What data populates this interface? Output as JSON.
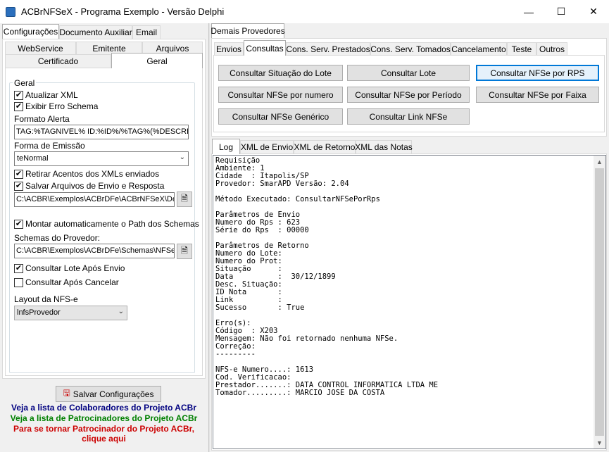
{
  "window": {
    "title": "ACBrNFSeX - Programa Exemplo - Versão Delphi",
    "minimize": "—",
    "maximize": "☐",
    "close": "✕"
  },
  "left": {
    "top_tabs": [
      "Configurações",
      "Documento Auxiliar",
      "Email"
    ],
    "sub_tabs_row1": [
      "WebService",
      "Emitente",
      "Arquivos"
    ],
    "sub_tabs_row2": [
      "Certificado",
      "Geral"
    ],
    "group_title": "Geral",
    "atualizar_xml": {
      "label": "Atualizar XML",
      "checked": true
    },
    "exibir_erro": {
      "label": "Exibir Erro Schema",
      "checked": true
    },
    "formato_alerta_label": "Formato Alerta",
    "formato_alerta_value": "TAG:%TAGNIVEL% ID:%ID%/%TAG%(%DESCRI",
    "forma_emissao_label": "Forma de Emissão",
    "forma_emissao_value": "teNormal",
    "retirar_acentos": {
      "label": "Retirar Acentos dos XMLs enviados",
      "checked": true
    },
    "salvar_arquivos": {
      "label": "Salvar Arquivos de Envio e Resposta",
      "checked": true
    },
    "path_value": "C:\\ACBR\\Exemplos\\ACBrDFe\\ACBrNFSeX\\Delp",
    "montar_path": {
      "label": "Montar automaticamente o Path dos Schemas",
      "checked": true
    },
    "schemas_label": "Schemas do Provedor:",
    "schemas_value": "C:\\ACBR\\Exemplos\\ACBrDFe\\Schemas\\NFSe",
    "consultar_lote": {
      "label": "Consultar Lote Após Envio",
      "checked": true
    },
    "consultar_cancelar": {
      "label": "Consultar Após Cancelar",
      "checked": false
    },
    "layout_label": "Layout da NFS-e",
    "layout_value": "lnfsProvedor",
    "save_button": "Salvar Configurações",
    "link_colaboradores": "Veja a lista de Colaboradores do Projeto ACBr",
    "link_patrocinadores": "Veja a lista de Patrocinadores do Projeto ACBr",
    "link_patrocinador_1": "Para se tornar Patrocinador do Projeto ACBr,",
    "link_patrocinador_2": "clique aqui",
    "colors": {
      "colaboradores": "#000080",
      "patrocinadores": "#008000",
      "patrocinador": "#cc0000"
    }
  },
  "right": {
    "top_tab": "Demais Provedores",
    "tabs": [
      "Envios",
      "Consultas",
      "Cons. Serv. Prestados",
      "Cons. Serv. Tomados",
      "Cancelamento",
      "Teste",
      "Outros"
    ],
    "buttons": [
      "Consultar Situação do Lote",
      "Consultar Lote",
      "Consultar NFSe por RPS",
      "Consultar NFSe por numero",
      "Consultar NFSe por Período",
      "Consultar NFSe por Faixa",
      "Consultar NFSe Genérico",
      "Consultar Link NFSe"
    ],
    "log_tabs": [
      "Log",
      "XML de Envio",
      "XML de Retorno",
      "XML das Notas"
    ],
    "log_text": "Requisição\nAmbiente: 1\nCidade  : Itapolis/SP\nProvedor: SmarAPD Versão: 2.04\n\nMétodo Executado: ConsultarNFSePorRps\n\nParâmetros de Envio\nNumero do Rps : 623\nSérie do Rps  : 00000\n\nParâmetros de Retorno\nNumero do Lote:\nNumero do Prot:\nSituação      :\nData          :  30/12/1899\nDesc. Situação:\nID Nota       :\nLink          :\nSucesso       : True\n\nErro(s):\nCódigo  : X203\nMensagem: Não foi retornado nenhuma NFSe.\nCorreção:\n---------\n\nNFS-e Numero....: 1613\nCod. Verificacao:\nPrestador.......: DATA CONTROL INFORMATICA LTDA ME\nTomador.........: MARCIO JOSE DA COSTA"
  }
}
